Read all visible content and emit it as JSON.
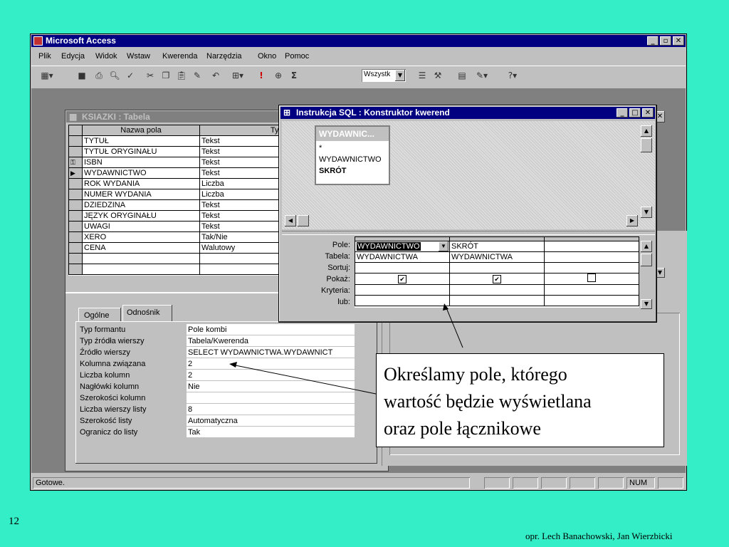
{
  "app": {
    "title": "Microsoft Access"
  },
  "menu": [
    "Plik",
    "Edycja",
    "Widok",
    "Wstaw",
    "Kwerenda",
    "Narzędzia",
    "Okno",
    "Pomoc"
  ],
  "toolbar": {
    "combo_value": "Wszystk",
    "sigma": "Σ",
    "exclaim": "!"
  },
  "table_window": {
    "title": "KSIAZKI : Tabela",
    "headers": [
      "Nazwa pola",
      "Typ danych"
    ],
    "rows": [
      {
        "name": "TYTUŁ",
        "type": "Tekst"
      },
      {
        "name": "TYTUŁ ORYGINAŁU",
        "type": "Tekst"
      },
      {
        "name": "ISBN",
        "type": "Tekst"
      },
      {
        "name": "WYDAWNICTWO",
        "type": "Tekst"
      },
      {
        "name": "ROK WYDANIA",
        "type": "Liczba"
      },
      {
        "name": "NUMER WYDANIA",
        "type": "Liczba"
      },
      {
        "name": "DZIEDZINA",
        "type": "Tekst"
      },
      {
        "name": "JĘZYK ORYGINAŁU",
        "type": "Tekst"
      },
      {
        "name": "UWAGI",
        "type": "Tekst"
      },
      {
        "name": "XERO",
        "type": "Tak/Nie"
      },
      {
        "name": "CENA",
        "type": "Walutowy"
      }
    ],
    "tabs": [
      "Ogólne",
      "Odnośnik"
    ],
    "props": [
      {
        "label": "Typ formantu",
        "value": "Pole kombi"
      },
      {
        "label": "Typ źródła wierszy",
        "value": "Tabela/Kwerenda"
      },
      {
        "label": "Źródło wierszy",
        "value": "SELECT WYDAWNICTWA.WYDAWNICT"
      },
      {
        "label": "Kolumna związana",
        "value": "2"
      },
      {
        "label": "Liczba kolumn",
        "value": "2"
      },
      {
        "label": "Nagłówki kolumn",
        "value": "Nie"
      },
      {
        "label": "Szerokości kolumn",
        "value": ""
      },
      {
        "label": "Liczba wierszy listy",
        "value": "8"
      },
      {
        "label": "Szerokość listy",
        "value": "Automatyczna"
      },
      {
        "label": "Ogranicz do listy",
        "value": "Tak"
      }
    ]
  },
  "sql_window": {
    "title": "Instrukcja SQL : Konstruktor kwerend",
    "table_box": {
      "title": "WYDAWNIC...",
      "fields": [
        "*",
        "WYDAWNICTWO",
        "SKRÓT"
      ]
    },
    "row_labels": [
      "Pole:",
      "Tabela:",
      "Sortuj:",
      "Pokaż:",
      "Kryteria:",
      "lub:"
    ],
    "columns": [
      {
        "field": "WYDAWNICTWO",
        "table": "WYDAWNICTWA",
        "show": true
      },
      {
        "field": "SKRÓT",
        "table": "WYDAWNICTWA",
        "show": true
      },
      {
        "field": "",
        "table": "",
        "show": false
      }
    ]
  },
  "status": {
    "text": "Gotowe.",
    "num": "NUM"
  },
  "callout": {
    "line1": "Określamy pole, którego",
    "line2": "wartość będzie wyświetlana",
    "line3": "oraz pole łącznikowe"
  },
  "slide": {
    "number": "12",
    "authors": "opr. Lech Banachowski, Jan Wierzbicki"
  }
}
